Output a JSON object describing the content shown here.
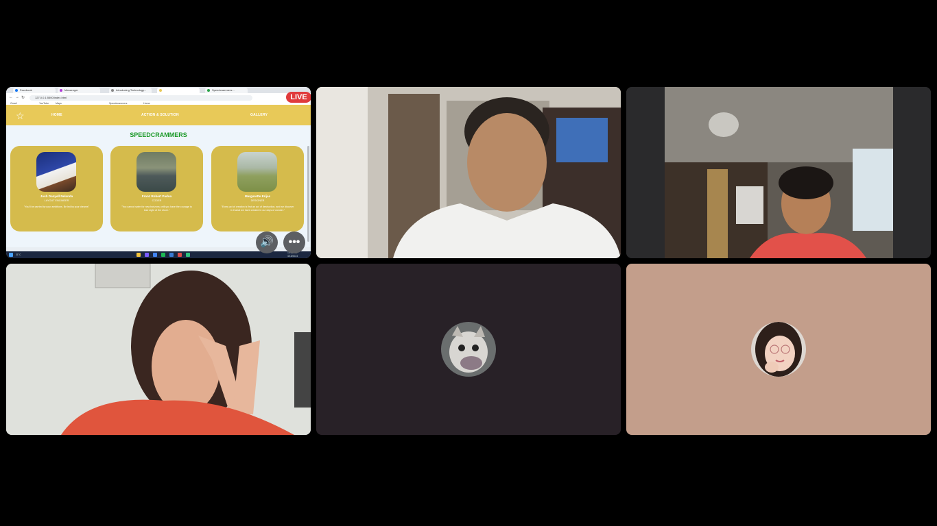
{
  "call": {
    "live_badge": "LIVE",
    "speaker_icon": "speaker-icon",
    "more_icon": "more-options-icon",
    "more_glyph": "•••",
    "speaker_glyph": "🔊"
  },
  "shared_screen": {
    "tabs": [
      "Facebook",
      "Messenger",
      "Introducing Technology...",
      "",
      "Speedcrammers..."
    ],
    "url": "127.0.0.1:5500/index.html",
    "bookmarks": [
      "Gmail",
      "YouTube",
      "Maps",
      "Speedcrammers",
      "Home"
    ],
    "site": {
      "logo_icon": "star-logo-icon",
      "nav": [
        "HOME",
        "ACTION & SOLUTION",
        "GALLERY"
      ],
      "title": "SPEEDCRAMMERS",
      "members": [
        {
          "name": "Josh Danyell Nelanda",
          "role": "LAYOUT ENGINEER",
          "quote": "\"You'll be carried by your ambitions. Be led by your dreams\""
        },
        {
          "name": "Franz Robert Padua",
          "role": "CODER",
          "quote": "\"You cannot swim for new horizons until you have the courage to lose sight of the shore.\""
        },
        {
          "name": "Margarette Erijas",
          "role": "DESIGNER",
          "quote": "\"Every act of creation is first an act of destruction, and we discover in it what we have created in our days of wonder.\""
        }
      ]
    },
    "taskbar": {
      "time": "10:51 AM",
      "date": "4/15/2024",
      "weather": "31°C"
    }
  },
  "participants": [
    {
      "label": "participant-screen-share"
    },
    {
      "label": "participant-camera-2"
    },
    {
      "label": "participant-camera-3"
    },
    {
      "label": "participant-camera-4"
    },
    {
      "label": "participant-avatar-cat"
    },
    {
      "label": "participant-avatar-girl"
    }
  ],
  "colors": {
    "background": "#000000",
    "site_nav": "#e8c958",
    "card": "#d5bb4c",
    "title_green": "#1d9a2a",
    "live_red": "#e03a3c",
    "tile_dark": "#282127",
    "tile_tan": "#c39e8b"
  }
}
